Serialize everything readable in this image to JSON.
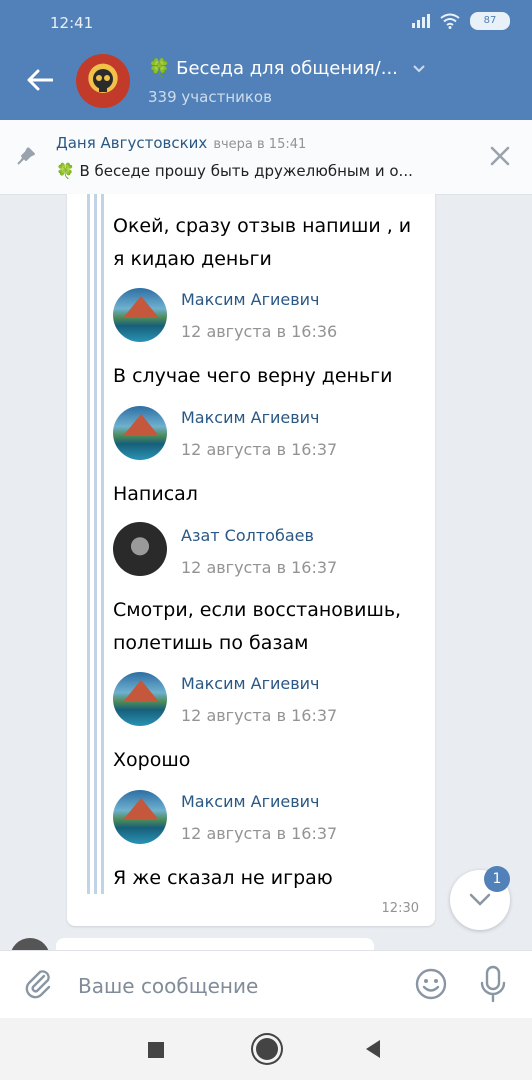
{
  "status_bar": {
    "time": "12:41",
    "battery": "87"
  },
  "header": {
    "title": "🍀 Беседа для общения/...",
    "subtitle": "339 участников"
  },
  "pinned": {
    "author": "Даня Августовских",
    "time": "вчера в 15:41",
    "text": "🍀 В беседе прошу быть дружелюбным и о..."
  },
  "messages": [
    {
      "text_lines": [
        "Окей, сразу отзыв напиши , и",
        "я кидаю деньги"
      ]
    },
    {
      "author": "Максим Агиевич",
      "time": "12 августа в 16:36",
      "text_lines": [
        "В случае чего верну деньги"
      ]
    },
    {
      "author": "Максим Агиевич",
      "time": "12 августа в 16:37",
      "text_lines": [
        "Написал"
      ]
    },
    {
      "author": "Азат Солтобаев",
      "time": "12 августа в 16:37",
      "text_lines": [
        "Смотри, если восстановишь,",
        "полетишь по базам"
      ]
    },
    {
      "author": "Максим Агиевич",
      "time": "12 августа в 16:37",
      "text_lines": [
        "Хорошо"
      ]
    },
    {
      "author": "Максим Агиевич",
      "time": "12 августа в 16:37",
      "text_lines": [
        "Я же сказал не играю"
      ]
    }
  ],
  "message_time": "12:30",
  "scroll_badge": "1",
  "composer": {
    "placeholder": "Ваше сообщение"
  },
  "icons": {
    "back": "arrow-left-icon",
    "pin": "pin-icon",
    "close": "close-icon",
    "attach": "paperclip-icon",
    "emoji": "smile-icon",
    "mic": "microphone-icon",
    "scroll": "chevron-down-icon"
  },
  "colors": {
    "header_bg": "#5181b8",
    "link": "#2a5885",
    "muted": "#939393"
  }
}
